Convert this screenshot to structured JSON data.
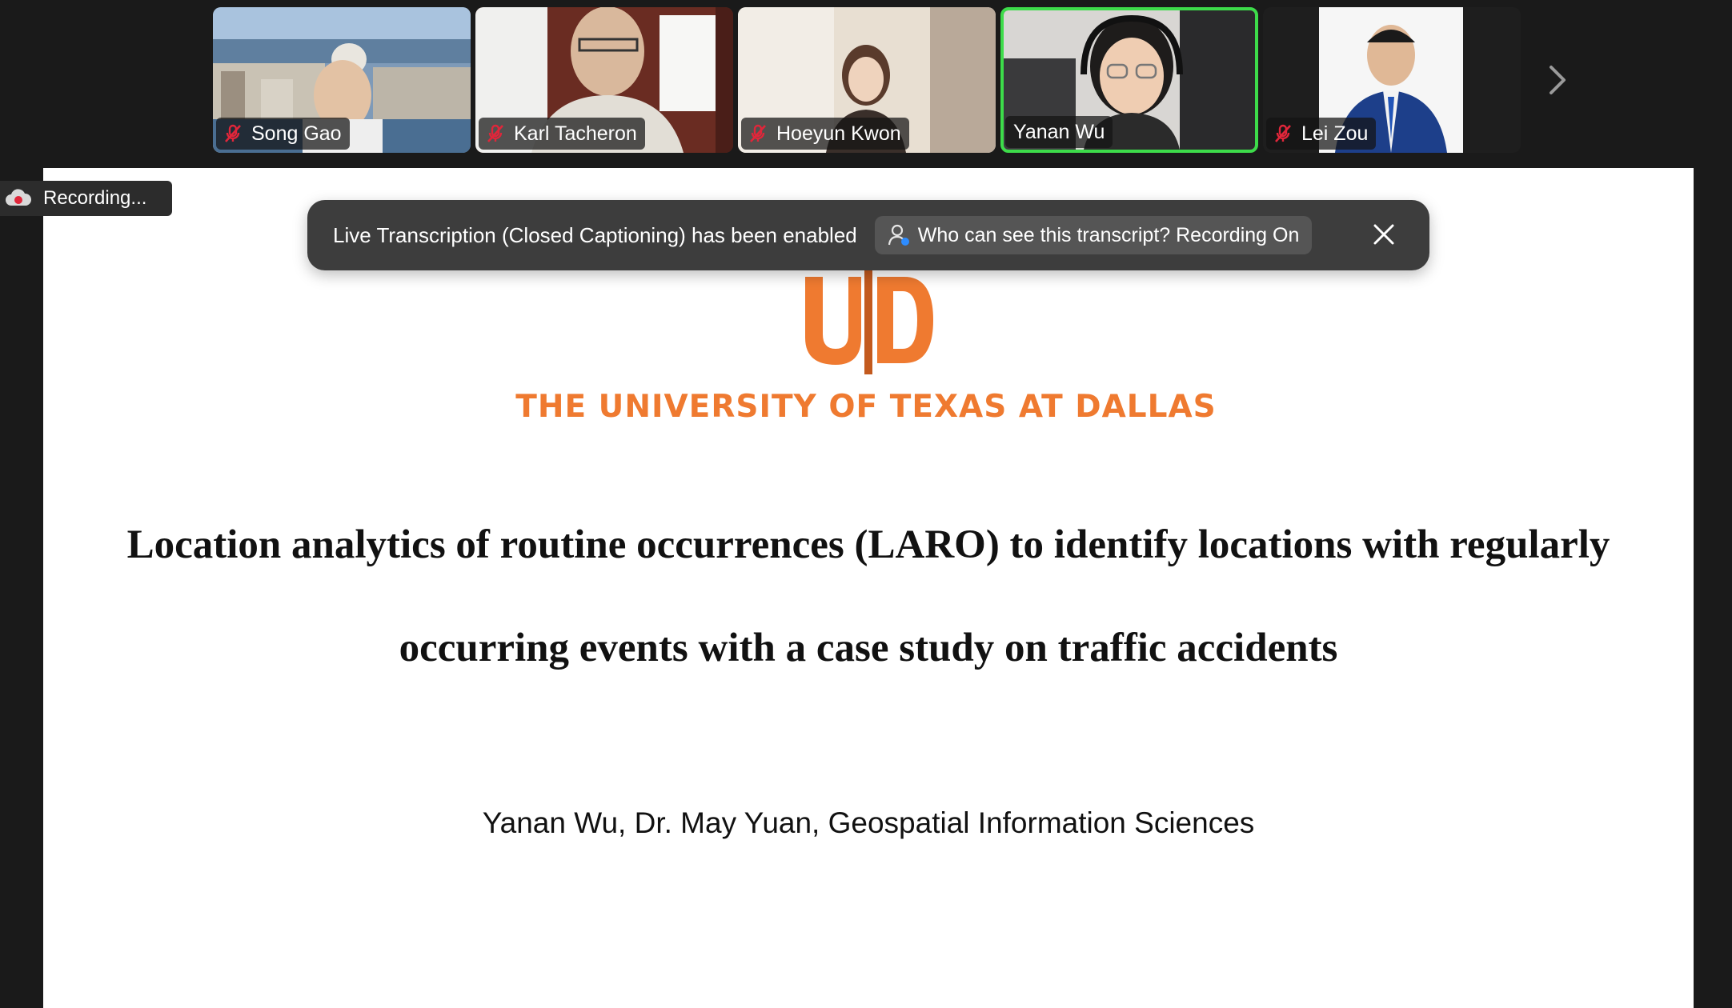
{
  "participants": [
    {
      "name": "Song Gao",
      "muted": true,
      "active": false
    },
    {
      "name": "Karl Tacheron",
      "muted": true,
      "active": false
    },
    {
      "name": "Hoeyun Kwon",
      "muted": true,
      "active": false
    },
    {
      "name": "Yanan Wu",
      "muted": false,
      "active": true
    },
    {
      "name": "Lei Zou",
      "muted": true,
      "active": false
    }
  ],
  "recording": {
    "label": "Recording..."
  },
  "transcription_banner": {
    "message": "Live Transcription (Closed Captioning) has been enabled",
    "who_button": "Who can see this transcript? Recording On"
  },
  "slide": {
    "logo_text": "UTD",
    "university": "THE UNIVERSITY OF TEXAS AT DALLAS",
    "title_line1": "Location analytics of routine occurrences (LARO) to identify locations with regularly",
    "title_line2": "occurring events with a case study on traffic accidents",
    "authors": "Yanan Wu, Dr. May Yuan, Geospatial Information Sciences"
  },
  "colors": {
    "accent_active": "#3ddc4a",
    "utd_orange": "#ef7a30",
    "mute_red": "#e0263a"
  },
  "icons": {
    "next": "chevron-right-icon",
    "muted": "mic-muted-icon",
    "close": "close-icon",
    "recording": "cloud-record-icon",
    "who": "person-icon"
  }
}
